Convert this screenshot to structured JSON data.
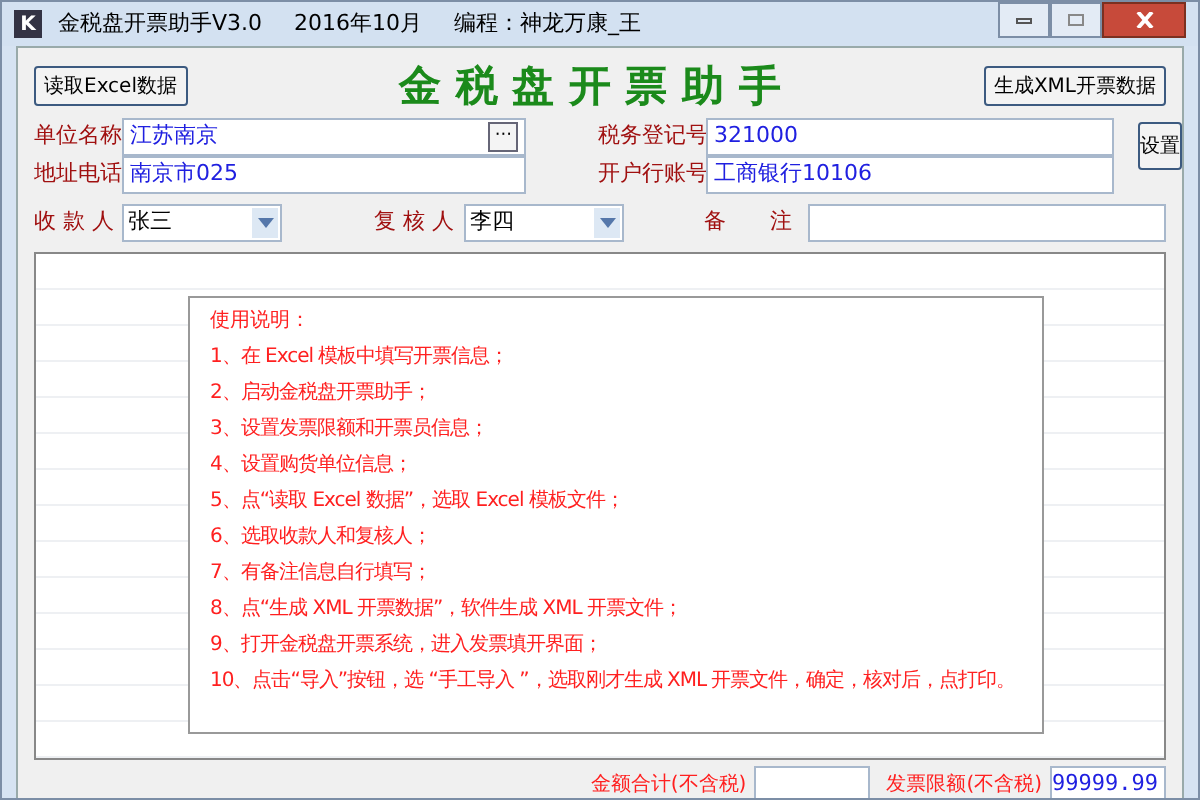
{
  "window": {
    "icon_letter": "K",
    "title": "金税盘开票助手V3.0",
    "date": "2016年10月",
    "author": "编程：神龙万康_王"
  },
  "toolbar": {
    "read_button": "读取Excel数据",
    "heading": "金 税 盘 开 票 助 手",
    "generate_button": "生成XML开票数据"
  },
  "fields": {
    "company_name": {
      "label": "单位名称",
      "value": "江苏南京",
      "browse": "···"
    },
    "address_phone": {
      "label": "地址电话",
      "value": "南京市025"
    },
    "tax_id": {
      "label": "税务登记号",
      "value": "321000"
    },
    "bank_account": {
      "label": "开户行账号",
      "value": "工商银行10106"
    },
    "settings_button": "设置",
    "payee": {
      "label": "收 款 人",
      "value": "张三"
    },
    "reviewer": {
      "label": "复 核 人",
      "value": "李四"
    },
    "remarks": {
      "label": "备　　注"
    }
  },
  "instructions": {
    "title": "使用说明：",
    "lines": [
      "1、在 Excel 模板中填写开票信息；",
      "2、启动金税盘开票助手；",
      "3、设置发票限额和开票员信息；",
      "4、设置购货单位信息；",
      "5、点“读取 Excel 数据”，选取 Excel 模板文件；",
      "6、选取收款人和复核人；",
      "7、有备注信息自行填写；",
      "8、点“生成 XML 开票数据”，软件生成 XML 开票文件；",
      "9、打开金税盘开票系统，进入发票填开界面；",
      "10、点击“导入”按钮，选 “手工导入 ”，选取刚才生成 XML 开票文件，确定，核对后，点打印。"
    ]
  },
  "footer": {
    "total_label": "金额合计(不含税)",
    "limit_label": "发票限额(不含税)",
    "limit_value": "99999.99"
  }
}
